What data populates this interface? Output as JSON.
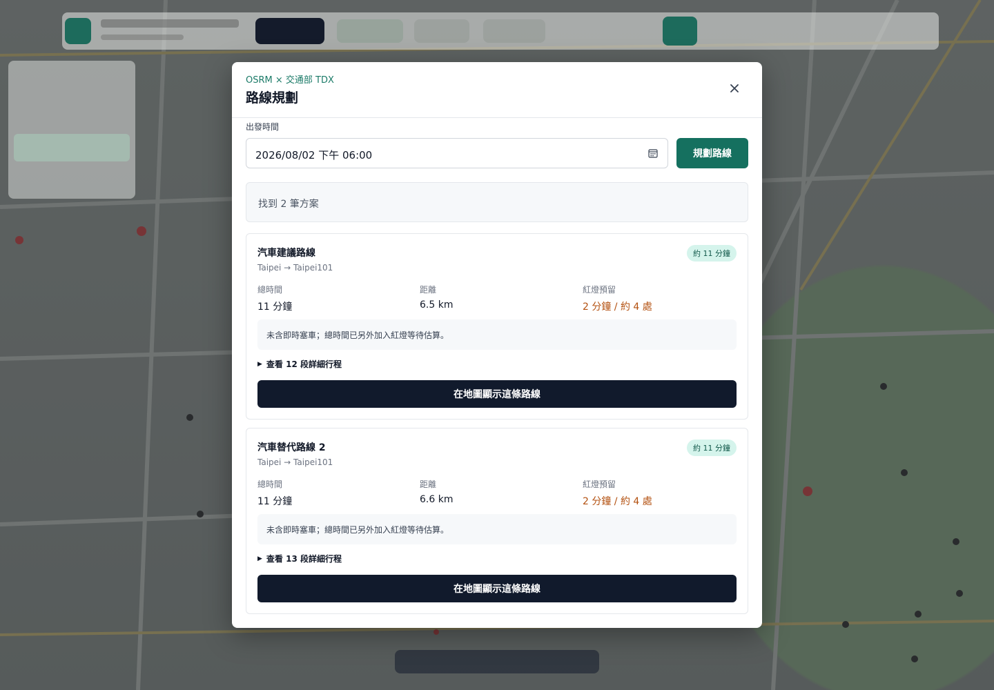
{
  "modal": {
    "eyebrow": "OSRM × 交通部 TDX",
    "title": "路線規劃",
    "close_label": "✕"
  },
  "form": {
    "departure_label": "出發時間",
    "departure_value": "2026/08/02 下午 06:00",
    "plan_button": "規劃路線"
  },
  "result_summary": "找到 2 筆方案",
  "routes": [
    {
      "name": "汽車建議路線",
      "from_to": "Taipei → Taipei101",
      "badge": "約 11 分鐘",
      "total_time_label": "總時間",
      "total_time_value": "11 分鐘",
      "distance_label": "距離",
      "distance_value": "6.5 km",
      "light_label": "紅燈預留",
      "light_value": "2 分鐘 / 約 4 處",
      "note": "未含即時塞車；總時間已另外加入紅燈等待估算。",
      "details_toggle": "查看 12 段詳細行程",
      "show_button": "在地圖顯示這條路線"
    },
    {
      "name": "汽車替代路線 2",
      "from_to": "Taipei → Taipei101",
      "badge": "約 11 分鐘",
      "total_time_label": "總時間",
      "total_time_value": "11 分鐘",
      "distance_label": "距離",
      "distance_value": "6.6 km",
      "light_label": "紅燈預留",
      "light_value": "2 分鐘 / 約 4 處",
      "note": "未含即時塞車；總時間已另外加入紅燈等待估算。",
      "details_toggle": "查看 13 段詳細行程",
      "show_button": "在地圖顯示這條路線"
    }
  ],
  "colors": {
    "accent": "#15705f",
    "dark_button": "#111a2c",
    "warning": "#b3500f",
    "badge_bg": "#d5f4ec"
  }
}
